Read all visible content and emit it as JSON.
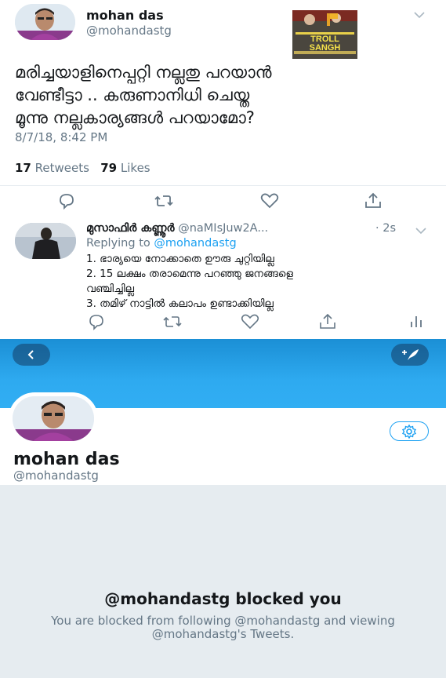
{
  "tweet": {
    "author_name": "mohan das",
    "author_handle": "@mohandastg",
    "text_lines": [
      "മരിച്ചയാളിനെപ്പറ്റി നല്ലതു പറയാൻ",
      "വേണ്ടീട്ടാ .. കരുണാനിധി ചെയ്ത",
      "മൂന്നു നല്ലകാര്യങ്ങൾ പറയാമോ?"
    ],
    "timestamp": "8/7/18, 8:42 PM",
    "retweets_count": "17",
    "retweets_label": "Retweets",
    "likes_count": "79",
    "likes_label": "Likes",
    "thumbnail_text": "TROLL SANGH"
  },
  "reply": {
    "author_name": "മുസാഫിർ കണ്ണൂർ",
    "author_handle": "@naMIsJuw2A...",
    "time": "· 2s",
    "replying_prefix": "Replying to",
    "replying_to": "@mohandastg",
    "lines": [
      "1. ഭാര്യയെ നോക്കാതെ ഊരു ചുറ്റിയില്ല",
      "2. 15 ലക്ഷം തരാമെന്നു പറഞ്ഞു ജനങ്ങളെ",
      "വഞ്ചിച്ചില്ല",
      "3. തമിഴ് നാട്ടിൽ കലാപം ഉണ്ടാക്കിയില്ല"
    ]
  },
  "profile": {
    "name": "mohan das",
    "handle": "@mohandastg"
  },
  "blocked": {
    "title": "@mohandastg blocked you",
    "description": "You are blocked from following @mohandastg and viewing @mohandastg's Tweets."
  },
  "colors": {
    "accent": "#1da1f2",
    "muted": "#657786",
    "banner": "#2eaaf0",
    "blocked_bg": "#e6ecf0"
  }
}
